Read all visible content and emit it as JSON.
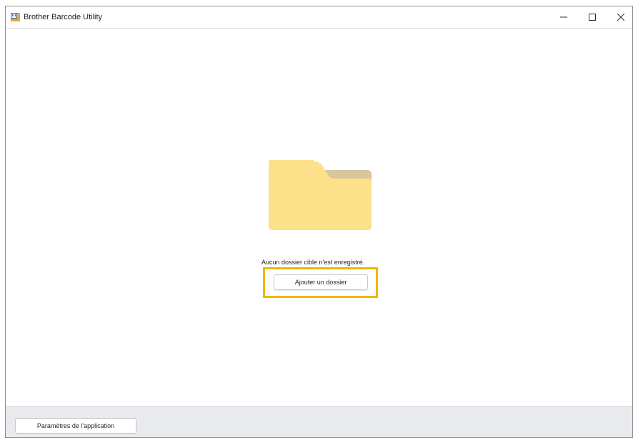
{
  "window": {
    "title": "Brother Barcode Utility",
    "app_icon": "brother-barcode-utility-icon",
    "controls": {
      "minimize_icon": "minimize-icon",
      "maximize_icon": "maximize-icon",
      "close_icon": "close-icon"
    }
  },
  "main": {
    "illustration_icon": "folder-icon",
    "empty_message": "Aucun dossier cible n'est enregistré.",
    "add_folder_label": "Ajouter un dossier"
  },
  "footer": {
    "settings_label": "Paramètres de l'application"
  },
  "colors": {
    "folder_body": "#fde08a",
    "folder_tab": "#d8c79a",
    "highlight": "#f2b600",
    "footer_bg": "#e9eaed"
  }
}
